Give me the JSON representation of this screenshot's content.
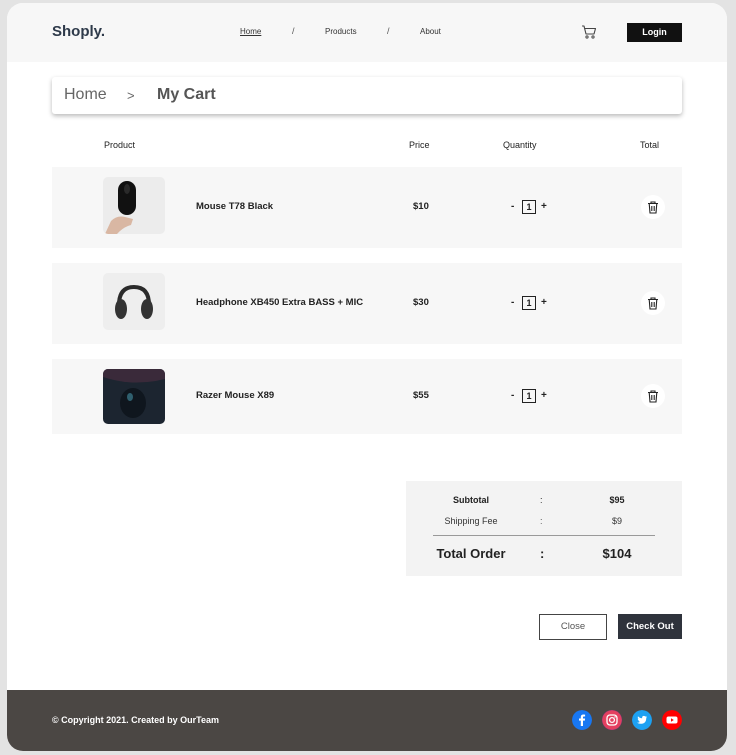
{
  "brand": {
    "logo": "Shoply."
  },
  "nav": {
    "home": "Home",
    "products": "Products",
    "about": "About",
    "separator": "/",
    "login": "Login"
  },
  "breadcrumb": {
    "home": "Home",
    "separator": ">",
    "current": "My Cart"
  },
  "table": {
    "headers": {
      "product": "Product",
      "price": "Price",
      "quantity": "Quantity",
      "total": "Total"
    }
  },
  "cart_items": [
    {
      "name": "Mouse T78 Black",
      "price": "$10",
      "qty": "1"
    },
    {
      "name": "Headphone XB450 Extra BASS + MIC",
      "price": "$30",
      "qty": "1"
    },
    {
      "name": "Razer Mouse X89",
      "price": "$55",
      "qty": "1"
    }
  ],
  "qty_controls": {
    "minus": "-",
    "plus": "+"
  },
  "summary": {
    "subtotal_label": "Subtotal",
    "subtotal": "$95",
    "shipping_label": "Shipping Fee",
    "shipping": "$9",
    "total_label": "Total Order",
    "total": "$104",
    "colon": ":"
  },
  "actions": {
    "close": "Close",
    "checkout": "Check Out"
  },
  "footer": {
    "copyright": "© Copyright 2021. Created by OurTeam"
  },
  "colors": {
    "accent_dark": "#2f333c",
    "footer_bg": "#4b4744",
    "row_bg": "#f7f7f7"
  },
  "icons": [
    "cart-icon",
    "trash-icon",
    "facebook-icon",
    "instagram-icon",
    "twitter-icon",
    "youtube-icon"
  ]
}
